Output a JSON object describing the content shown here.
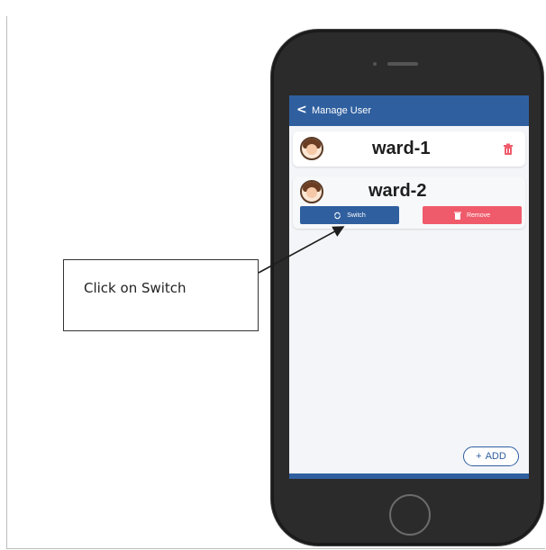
{
  "screen": {
    "header": {
      "back": "<",
      "title": "Manage User"
    },
    "users": [
      {
        "name": "ward-1"
      },
      {
        "name": "ward-2",
        "switch_label": "Switch",
        "remove_label": "Remove"
      }
    ],
    "add_label": "ADD",
    "add_icon": "+"
  },
  "annotation": {
    "callout_text": "Click on Switch"
  },
  "colors": {
    "primary": "#2f5f9f",
    "danger": "#ef5b6b"
  }
}
